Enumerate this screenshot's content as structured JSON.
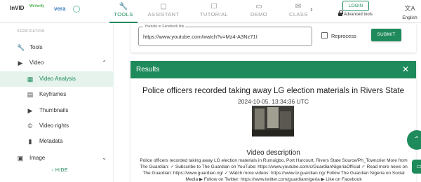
{
  "logo": {
    "invid": "InVID",
    "weverify": "WeVerify",
    "vera": "vera",
    "vera_suffix": "ai"
  },
  "nav": {
    "tools": {
      "label": "TOOLS",
      "icon": "wrench-icon",
      "glyph": "🔧"
    },
    "assistant": {
      "label": "ASSISTANT",
      "icon": "assistant-icon",
      "glyph": "▢"
    },
    "tutorial": {
      "label": "TUTORIAL",
      "icon": "tutorial-icon",
      "glyph": "☐"
    },
    "demo": {
      "label": "DEMO",
      "icon": "demo-icon",
      "glyph": "▭"
    },
    "classroom": {
      "label": "CLASSRO",
      "icon": "classroom-icon",
      "glyph": "✉"
    },
    "more_glyph": "›"
  },
  "account": {
    "login": "LOGIN",
    "advanced": "Advanced tools"
  },
  "language": {
    "glyph": "文A",
    "label": "English"
  },
  "sidebar": {
    "section": "VERIFICATION",
    "items": [
      {
        "label": "Tools",
        "glyph": "🔧"
      },
      {
        "label": "Video",
        "glyph": "▶"
      },
      {
        "label": "Video Analysis",
        "glyph": "▦"
      },
      {
        "label": "Keyframes",
        "glyph": "▤"
      },
      {
        "label": "Thumbnails",
        "glyph": "▶"
      },
      {
        "label": "Video rights",
        "glyph": "©"
      },
      {
        "label": "Metadata",
        "glyph": "▮"
      },
      {
        "label": "Image",
        "glyph": "▣"
      }
    ],
    "expand_glyph": "⌃",
    "collapse_glyph": "⌄",
    "hide": "‹  HIDE"
  },
  "url_form": {
    "field_label": "Youtube or Facebook link",
    "value": "https://www.youtube.com/watch?v=Mz4-A3Nz71I",
    "reprocess": "Reprocess",
    "submit": "SUBMIT"
  },
  "results": {
    "title": "Results",
    "close_glyph": "✕",
    "video_title": "Police officers recorded taking away LG election materials in Rivers State",
    "date": "2024-10-05, 13:34:36 UTC",
    "description_heading": "Video description",
    "description": "Police officers recorded taking away LG election materials in Rumuigbo, Port Harcourt, Rivers State Source/Ph_Towncrier More from The Guardian: ✓ Subscribe to The Guardian on YouTube: https://www.youtube.com/c/GuardianNigeriaOfficial ✓ Read more news on The Guardian: https://www.guardian.ng/ ✓ Watch more videos: https://www.tv.guardian.ng/ Follow The Guardian Nigeria on Social Media ▶ Follow on Twitter: https://www.twitter.com/guardiannigeria ▶ Like on Facebook"
  },
  "fab": {
    "glyph": "⌃",
    "chat_glyph": "▭"
  },
  "colors": {
    "accent": "#1f8a5b",
    "selected_bg": "#e5f3ec"
  }
}
